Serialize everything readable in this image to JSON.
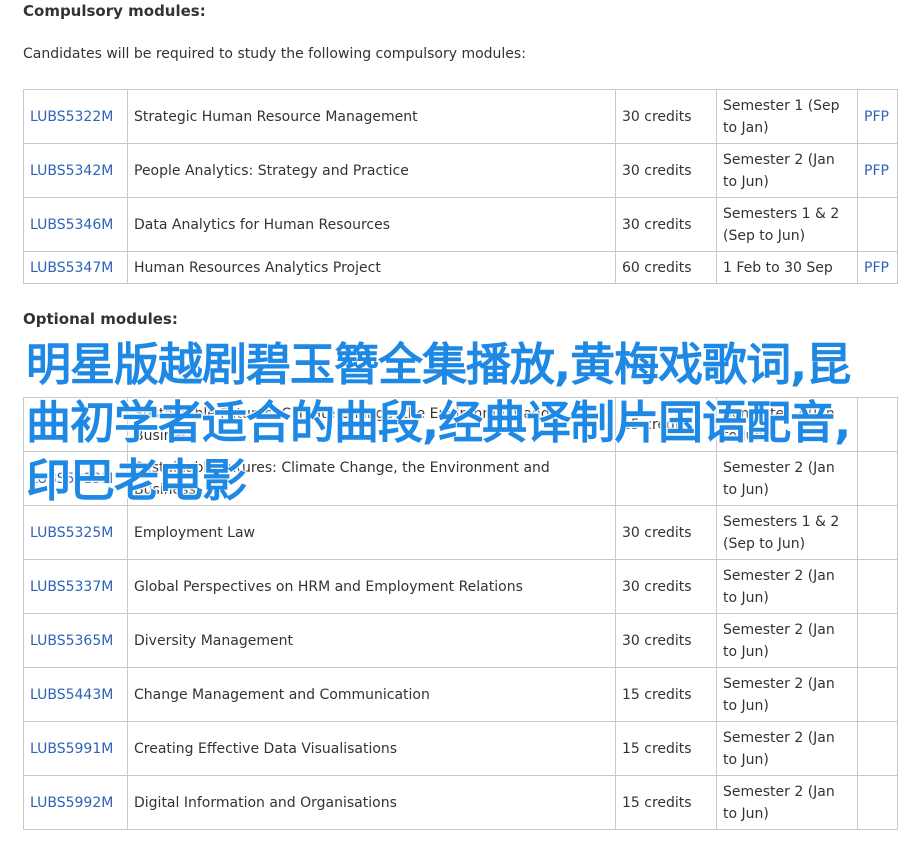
{
  "compulsory": {
    "heading": "Compulsory modules:",
    "intro": "Candidates will be required to study the following compulsory modules:",
    "rows": [
      {
        "code": "LUBS5322M",
        "title": "Strategic Human Resource Management",
        "credits": "30 credits",
        "semester": "Semester 1 (Sep to Jan)",
        "pfp": "PFP"
      },
      {
        "code": "LUBS5342M",
        "title": "People Analytics: Strategy and Practice",
        "credits": "30 credits",
        "semester": "Semester 2 (Jan to Jun)",
        "pfp": "PFP"
      },
      {
        "code": "LUBS5346M",
        "title": "Data Analytics for Human Resources",
        "credits": "30 credits",
        "semester": "Semesters 1 & 2 (Sep to Jun)",
        "pfp": ""
      },
      {
        "code": "LUBS5347M",
        "title": "Human Resources Analytics Project",
        "credits": "60 credits",
        "semester": "1 Feb to 30 Sep",
        "pfp": "PFP"
      }
    ]
  },
  "optional": {
    "heading": "Optional modules:",
    "rows": [
      {
        "code": "",
        "title": "Sustainable Futures: Climate Change, the Environment and Business",
        "credits": "15 credits",
        "semester": "Semester 2 (Jan to Jun)",
        "pfp": ""
      },
      {
        "code": "LUBS5313M",
        "title": "Sustainable Futures: Climate Change, the Environment and Business",
        "credits": "",
        "semester": "Semester 2 (Jan to Jun)",
        "pfp": ""
      },
      {
        "code": "LUBS5325M",
        "title": "Employment Law",
        "credits": "30 credits",
        "semester": "Semesters 1 & 2 (Sep to Jun)",
        "pfp": ""
      },
      {
        "code": "LUBS5337M",
        "title": "Global Perspectives on HRM and Employment Relations",
        "credits": "30 credits",
        "semester": "Semester 2 (Jan to Jun)",
        "pfp": ""
      },
      {
        "code": "LUBS5365M",
        "title": "Diversity Management",
        "credits": "30 credits",
        "semester": "Semester 2 (Jan to Jun)",
        "pfp": ""
      },
      {
        "code": "LUBS5443M",
        "title": "Change Management and Communication",
        "credits": "15 credits",
        "semester": "Semester 2 (Jan to Jun)",
        "pfp": ""
      },
      {
        "code": "LUBS5991M",
        "title": "Creating Effective Data Visualisations",
        "credits": "15 credits",
        "semester": "Semester 2 (Jan to Jun)",
        "pfp": ""
      },
      {
        "code": "LUBS5992M",
        "title": "Digital Information and Organisations",
        "credits": "15 credits",
        "semester": "Semester 2 (Jan to Jun)",
        "pfp": ""
      }
    ]
  },
  "overlay_text": "明星版越剧碧玉簪全集播放,黄梅戏歌词,昆曲初学者适合的曲段,经典译制片国语配音,印巴老电影",
  "colors": {
    "link": "#2f63b6",
    "overlay": "#1e88e5",
    "border": "#c8c8c8"
  }
}
